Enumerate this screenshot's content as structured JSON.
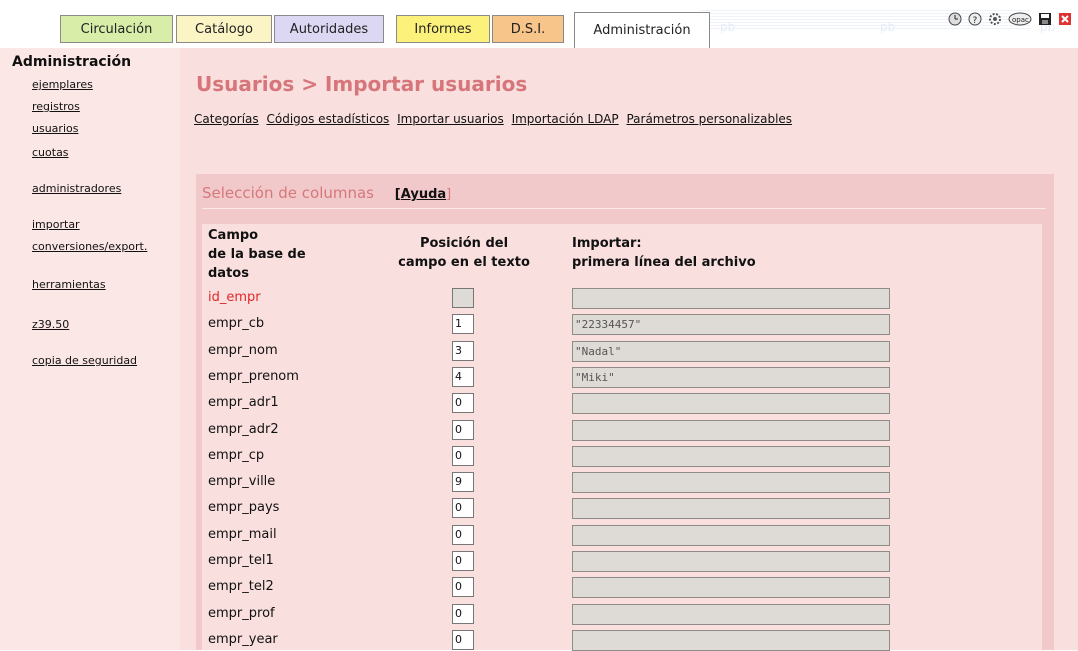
{
  "tabs": [
    {
      "label": "Circulación"
    },
    {
      "label": "Catálogo"
    },
    {
      "label": "Autoridades"
    },
    {
      "label": "Informes"
    },
    {
      "label": "D.S.I."
    },
    {
      "label": "Administración",
      "active": true
    }
  ],
  "watermark_text": "pb",
  "top_icons": [
    "clock-icon",
    "help-icon",
    "settings-icon",
    "opac-icon",
    "save-icon",
    "close-icon"
  ],
  "sidebar": {
    "title": "Administración",
    "links": [
      "ejemplares",
      "registros",
      "usuarios",
      "cuotas",
      "administradores",
      "importar",
      "conversiones/export.",
      "herramientas",
      "z39.50",
      "copia de seguridad"
    ]
  },
  "page": {
    "heading": "Usuarios > Importar usuarios",
    "subnav": [
      "Categorías",
      "Códigos estadísticos",
      "Importar usuarios",
      "Importación LDAP",
      "Parámetros personalizables"
    ]
  },
  "panel": {
    "title": "Selección de columnas",
    "help_label": "Ayuda",
    "col_field": [
      "Campo",
      "de la base de",
      "datos"
    ],
    "col_position": [
      "Posición del",
      "campo en el texto"
    ],
    "col_import": [
      "Importar:",
      "primera línea del archivo"
    ]
  },
  "fields": [
    {
      "name": "id_empr",
      "position": "",
      "preview": "",
      "required": true
    },
    {
      "name": "empr_cb",
      "position": "1",
      "preview": "\"22334457\""
    },
    {
      "name": "empr_nom",
      "position": "3",
      "preview": "\"Nadal\""
    },
    {
      "name": "empr_prenom",
      "position": "4",
      "preview": "\"Miki\""
    },
    {
      "name": "empr_adr1",
      "position": "0",
      "preview": ""
    },
    {
      "name": "empr_adr2",
      "position": "0",
      "preview": ""
    },
    {
      "name": "empr_cp",
      "position": "0",
      "preview": ""
    },
    {
      "name": "empr_ville",
      "position": "9",
      "preview": ""
    },
    {
      "name": "empr_pays",
      "position": "0",
      "preview": ""
    },
    {
      "name": "empr_mail",
      "position": "0",
      "preview": ""
    },
    {
      "name": "empr_tel1",
      "position": "0",
      "preview": ""
    },
    {
      "name": "empr_tel2",
      "position": "0",
      "preview": ""
    },
    {
      "name": "empr_prof",
      "position": "0",
      "preview": ""
    },
    {
      "name": "empr_year",
      "position": "0",
      "preview": ""
    }
  ],
  "colors": {
    "accent": "#d6757a",
    "sidebar_bg": "#fbe8e6",
    "panel_bg": "#f2c9ca",
    "required": "#e02828"
  }
}
